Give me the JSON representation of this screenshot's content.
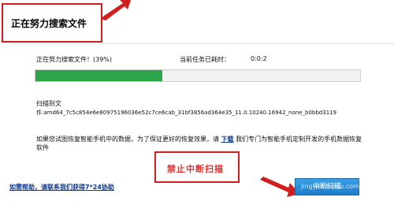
{
  "header": {
    "title": "正在努力搜索文件"
  },
  "progress": {
    "status": "正在努力搜索文件！(39%)",
    "percent": 39,
    "elapsed_label": "当前任务已耗时：",
    "elapsed_value": "0:0:2"
  },
  "scan": {
    "label": "扫描到文",
    "file": "件:amd64_7c5c854e6e80975196036e52c7ce6cab_31bf3856ad364e35_11.0.10240.16942_none_b0bbd3119"
  },
  "info": {
    "text_before": "如果您试图恢复智能手机中的数据，为了保证更好的恢复效果，请",
    "link": "下载",
    "text_after": "我们专门为智能手机定制开发的手机数据恢复软件"
  },
  "annotation": {
    "stop_callout": "禁止中断扫描"
  },
  "footer": {
    "help_link": "如需帮助，请联系我们获得7*24协助",
    "stop_button": "中断扫描"
  },
  "watermark": {
    "main": "Bai",
    "sub": "jingyan.baidu.com"
  },
  "colors": {
    "annotation_red": "#d21e1e",
    "progress_green": "#2da44a",
    "link_blue": "#0b3b9a",
    "button_blue": "#1e7cc8"
  }
}
